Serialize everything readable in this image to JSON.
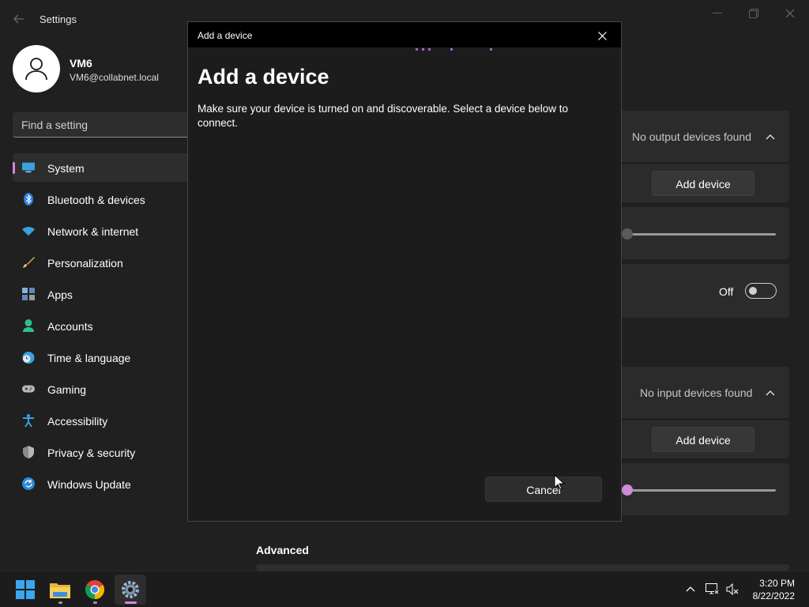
{
  "app": {
    "title": "Settings"
  },
  "user": {
    "name": "VM6",
    "email": "VM6@collabnet.local"
  },
  "search": {
    "placeholder": "Find a setting"
  },
  "nav": {
    "items": [
      {
        "label": "System",
        "icon": "system-icon",
        "selected": true
      },
      {
        "label": "Bluetooth & devices",
        "icon": "bluetooth-icon"
      },
      {
        "label": "Network & internet",
        "icon": "wifi-icon"
      },
      {
        "label": "Personalization",
        "icon": "brush-icon"
      },
      {
        "label": "Apps",
        "icon": "apps-icon"
      },
      {
        "label": "Accounts",
        "icon": "person-icon"
      },
      {
        "label": "Time & language",
        "icon": "clock-globe-icon"
      },
      {
        "label": "Gaming",
        "icon": "gamepad-icon"
      },
      {
        "label": "Accessibility",
        "icon": "accessibility-icon"
      },
      {
        "label": "Privacy & security",
        "icon": "shield-icon"
      },
      {
        "label": "Windows Update",
        "icon": "update-icon"
      }
    ]
  },
  "output": {
    "status": "No output devices found",
    "add_button": "Add device",
    "volume": 0
  },
  "mono_audio": {
    "state": "Off",
    "on": false
  },
  "input": {
    "status": "No input devices found",
    "add_button": "Add device",
    "volume": 0
  },
  "advanced": {
    "heading": "Advanced"
  },
  "dialog": {
    "window_title": "Add a device",
    "heading": "Add a device",
    "description": "Make sure your device is turned on and discoverable. Select a device below to connect.",
    "cancel_label": "Cancel"
  },
  "taskbar": {
    "apps": [
      "start-icon",
      "file-explorer-icon",
      "chrome-icon",
      "settings-icon"
    ],
    "active_app": "settings-icon",
    "time": "3:20 PM",
    "date": "8/22/2022"
  },
  "colors": {
    "accent": "#d08ad8",
    "background": "#202020",
    "card": "#2b2b2b",
    "dialog": "#1c1c1c"
  }
}
